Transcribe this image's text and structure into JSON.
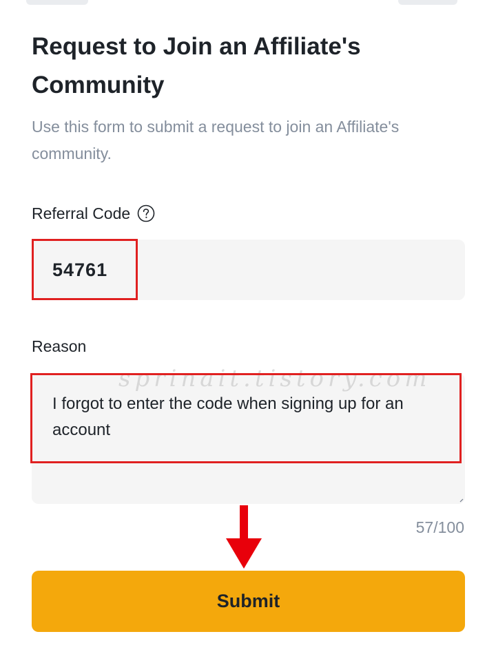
{
  "form": {
    "title": "Request to Join an Affiliate's Community",
    "subtitle": "Use this form to submit a request to join an Affiliate's community.",
    "referral_label": "Referral Code",
    "referral_value": "54761",
    "reason_label": "Reason",
    "reason_value": "I forgot to enter the code when signing up for an account",
    "char_counter": "57/100",
    "submit_label": "Submit"
  },
  "overlay": {
    "watermark": "sprinait.tistory.com"
  },
  "icons": {
    "help": "question-circle-icon",
    "arrow": "arrow-down-icon"
  },
  "colors": {
    "accent": "#f4a80c",
    "highlight": "#e02020",
    "muted_text": "#848e9c",
    "input_bg": "#f5f5f5"
  }
}
